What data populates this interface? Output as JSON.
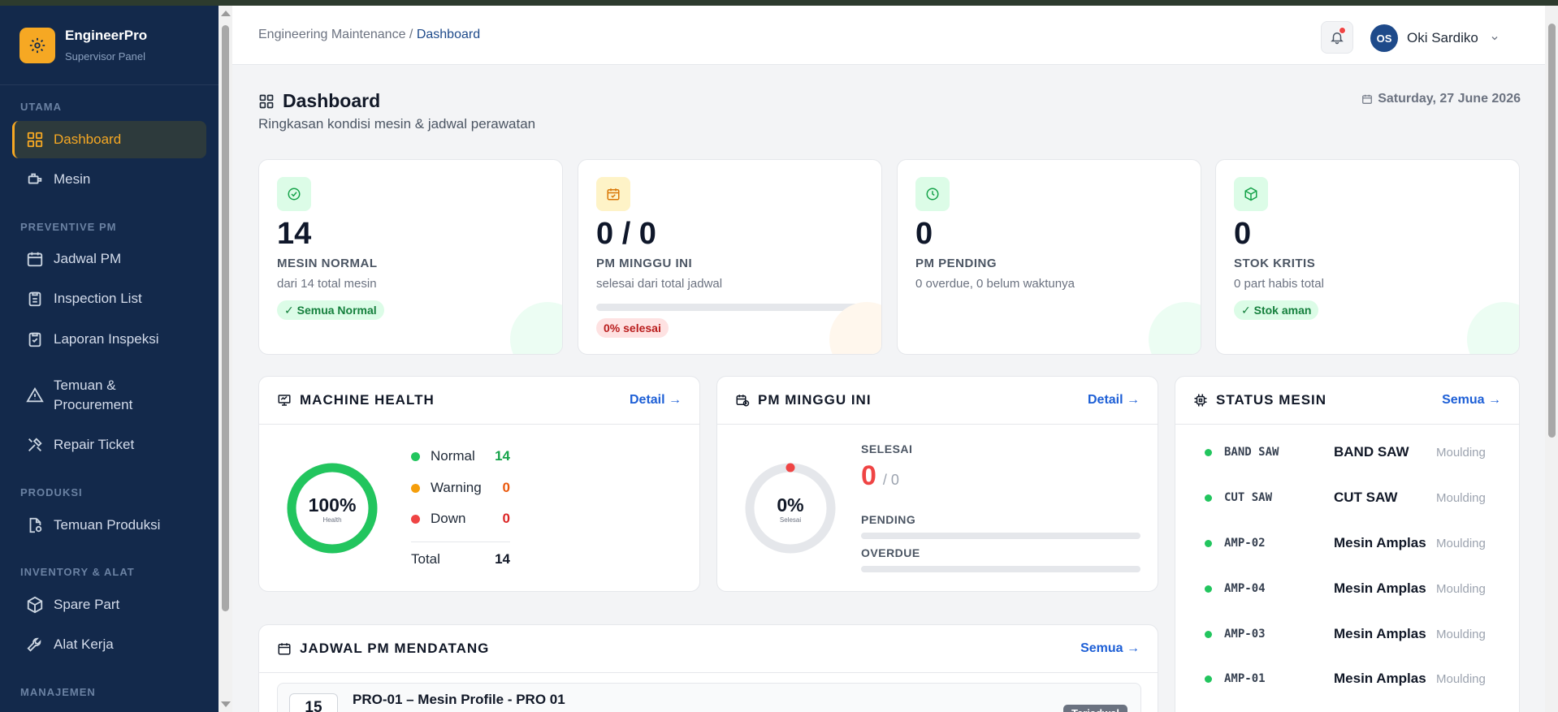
{
  "app": {
    "name": "EngineerPro",
    "subtitle": "Supervisor Panel"
  },
  "sidebar": {
    "sections": {
      "utama": "UTAMA",
      "preventive": "PREVENTIVE PM",
      "produksi": "PRODUKSI",
      "inventory": "INVENTORY & ALAT",
      "manajemen": "MANAJEMEN"
    },
    "items": {
      "dashboard": "Dashboard",
      "mesin": "Mesin",
      "jadwal_pm": "Jadwal PM",
      "inspection_list": "Inspection List",
      "laporan_inspeksi": "Laporan Inspeksi",
      "temuan_line1": "Temuan &",
      "temuan_line2": "Procurement",
      "repair_ticket": "Repair Ticket",
      "temuan_produksi": "Temuan Produksi",
      "spare_part": "Spare Part",
      "alat_kerja": "Alat Kerja"
    }
  },
  "header": {
    "breadcrumb_parent": "Engineering Maintenance",
    "breadcrumb_sep": " / ",
    "breadcrumb_current": "Dashboard",
    "user_initials": "OS",
    "user_name": "Oki Sardiko"
  },
  "page": {
    "title": "Dashboard",
    "subtitle": "Ringkasan kondisi mesin & jadwal perawatan",
    "date": "Saturday, 27 June 2026"
  },
  "stats": {
    "normal": {
      "value": "14",
      "label": "MESIN NORMAL",
      "sub": "dari 14 total mesin",
      "badge": "✓ Semua Normal"
    },
    "pm_week": {
      "value": "0 / 0",
      "label": "PM MINGGU INI",
      "sub": "selesai dari total jadwal",
      "badge": "0% selesai",
      "progress": 0
    },
    "pending": {
      "value": "0",
      "label": "PM PENDING",
      "sub": "0 overdue, 0 belum waktunya"
    },
    "stok": {
      "value": "0",
      "label": "STOK KRITIS",
      "sub": "0 part habis total",
      "badge": "✓ Stok aman"
    }
  },
  "machine_health": {
    "title": "MACHINE HEALTH",
    "link": "Detail →",
    "percent": "100%",
    "percent_caption": "Health",
    "health_fraction": 1.0,
    "rows": [
      {
        "label": "Normal",
        "value": "14",
        "color": "#22c55e"
      },
      {
        "label": "Warning",
        "value": "0",
        "color": "#f59e0b"
      },
      {
        "label": "Down",
        "value": "0",
        "color": "#ef4444"
      }
    ],
    "total_label": "Total",
    "total_value": "14"
  },
  "pm_week_panel": {
    "title": "PM MINGGU INI",
    "link": "Detail →",
    "percent": "0%",
    "percent_caption": "Selesai",
    "selesai_label": "SELESAI",
    "selesai_value": "0",
    "selesai_total": "/ 0",
    "pending_label": "PENDING",
    "overdue_label": "OVERDUE"
  },
  "status_mesin": {
    "title": "STATUS MESIN",
    "link": "Semua →",
    "rows": [
      {
        "code": "BAND SAW",
        "name": "BAND SAW",
        "dept": "Moulding"
      },
      {
        "code": "CUT SAW",
        "name": "CUT SAW",
        "dept": "Moulding"
      },
      {
        "code": "AMP-02",
        "name": "Mesin Amplas",
        "dept": "Moulding"
      },
      {
        "code": "AMP-04",
        "name": "Mesin Amplas",
        "dept": "Moulding"
      },
      {
        "code": "AMP-03",
        "name": "Mesin Amplas",
        "dept": "Moulding"
      },
      {
        "code": "AMP-01",
        "name": "Mesin Amplas",
        "dept": "Moulding"
      }
    ]
  },
  "jadwal": {
    "title": "JADWAL PM MENDATANG",
    "link": "Semua →",
    "first_day": "15",
    "first_title": "PRO-01 – Mesin Profile - PRO 01",
    "first_badge": "Terjadwal"
  }
}
